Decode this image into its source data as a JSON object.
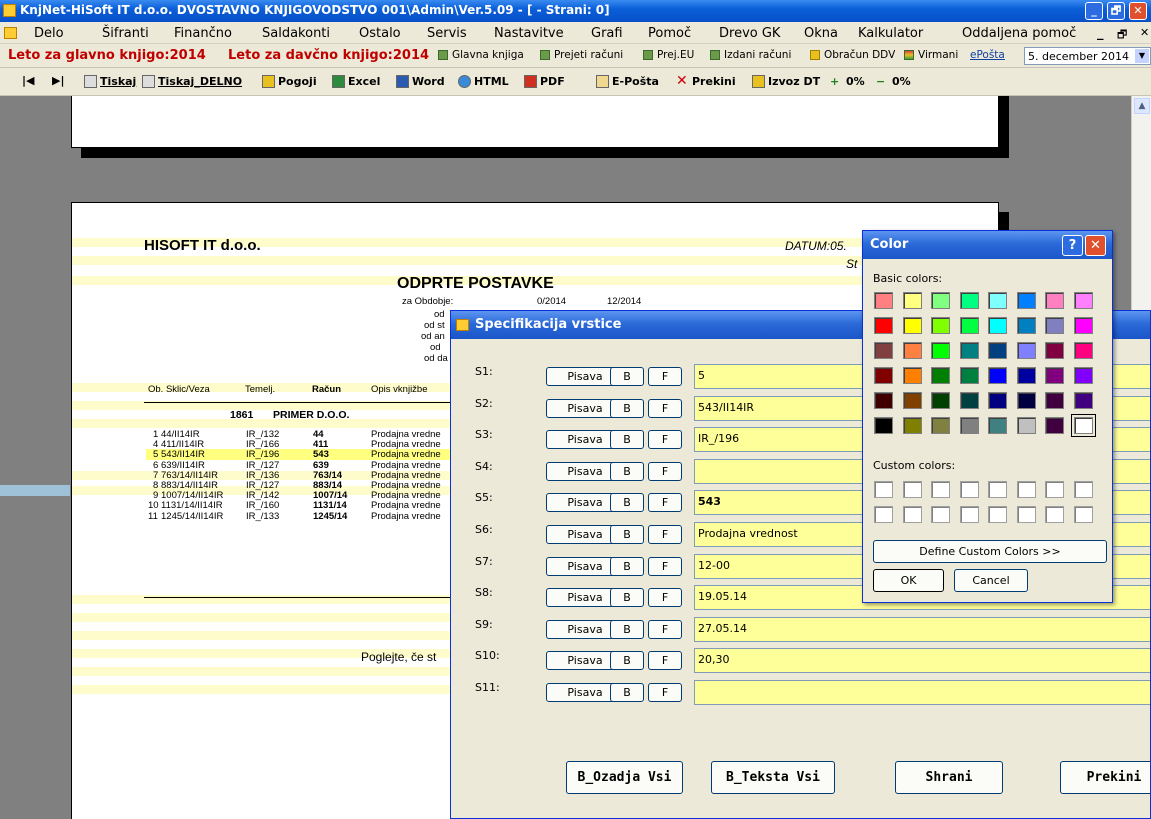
{
  "window": {
    "title": "KnjNet-HiSoft IT d.o.o. DVOSTAVNO KNJIGOVODSTVO 001\\Admin\\Ver.5.09 - [ - Strani: 0]",
    "min": "_",
    "max": "🗗",
    "close": "✕"
  },
  "menu": {
    "items": [
      "Delo",
      "Šifranti",
      "Finančno",
      "Saldakonti",
      "Ostalo",
      "Servis",
      "Nastavitve",
      "Grafi",
      "Pomoč",
      "Drevo GK",
      "Okna",
      "Kalkulator",
      "Oddaljena pomoč"
    ],
    "right_min": "_",
    "right_max": "🗗",
    "right_close": "✕"
  },
  "linkbar": {
    "year_main": "Leto za glavno knjigo:2014",
    "year_tax": "Leto za davčno knjigo:2014",
    "links": [
      "Glavna knjiga",
      "Prejeti računi",
      "Prej.EU",
      "Izdani računi",
      "Obračun DDV",
      "Virmani",
      "ePošta"
    ],
    "date": "5. december 2014"
  },
  "toolbar": {
    "items": [
      "Tiskaj",
      "Tiskaj_DELNO",
      "Pogoji",
      "Excel",
      "Word",
      "HTML",
      "PDF",
      "E-Pošta",
      "Prekini",
      "Izvoz DT",
      "0%",
      "0%"
    ]
  },
  "report": {
    "company": "HISOFT IT d.o.o.",
    "datum": "DATUM:05.",
    "stran": "St",
    "title": "ODPRTE POSTAVKE",
    "period_label": "za Obdobje:",
    "period_from": "0/2014",
    "period_to": "12/2014",
    "filters": [
      "od",
      "od st",
      "od an",
      "od",
      "od da"
    ],
    "headers": {
      "ob": "Ob. Sklic/Veza",
      "temelj": "Temelj.",
      "racun": "Račun",
      "opis": "Opis vknjižbe"
    },
    "partner_code": "1861",
    "partner_name": "PRIMER D.O.O.",
    "rows": [
      {
        "ob": "1",
        "sklic": "44/II14IR",
        "temelj": "IR_/132",
        "racun": "44",
        "opis": "Prodajna vredne"
      },
      {
        "ob": "4",
        "sklic": "411/II14IR",
        "temelj": "IR_/166",
        "racun": "411",
        "opis": "Prodajna vredne"
      },
      {
        "ob": "5",
        "sklic": "543/II14IR",
        "temelj": "IR_/196",
        "racun": "543",
        "opis": "Prodajna vredne"
      },
      {
        "ob": "6",
        "sklic": "639/II14IR",
        "temelj": "IR_/127",
        "racun": "639",
        "opis": "Prodajna vredne"
      },
      {
        "ob": "7",
        "sklic": "763/14/II14IR",
        "temelj": "IR_/136",
        "racun": "763/14",
        "opis": "Prodajna vredne"
      },
      {
        "ob": "8",
        "sklic": "883/14/II14IR",
        "temelj": "IR_/127",
        "racun": "883/14",
        "opis": "Prodajna vredne"
      },
      {
        "ob": "9",
        "sklic": "1007/14/II14IR",
        "temelj": "IR_/142",
        "racun": "1007/14",
        "opis": "Prodajna vredne"
      },
      {
        "ob": "10",
        "sklic": "1131/14/II14IR",
        "temelj": "IR_/160",
        "racun": "1131/14",
        "opis": "Prodajna vredne"
      },
      {
        "ob": "11",
        "sklic": "1245/14/II14IR",
        "temelj": "IR_/133",
        "racun": "1245/14",
        "opis": "Prodajna vredne"
      }
    ],
    "footer": "Poglejte, če st"
  },
  "spec_dialog": {
    "title": "Specifikacija vrstice",
    "pisava": "Pisava",
    "b": "B",
    "f": "F",
    "rows": [
      {
        "label": "S1:",
        "value": "5"
      },
      {
        "label": "S2:",
        "value": "543/II14IR"
      },
      {
        "label": "S3:",
        "value": "IR_/196"
      },
      {
        "label": "S4:",
        "value": ""
      },
      {
        "label": "S5:",
        "value": "543"
      },
      {
        "label": "S6:",
        "value": "Prodajna vrednost"
      },
      {
        "label": "S7:",
        "value": "12-00"
      },
      {
        "label": "S8:",
        "value": "19.05.14"
      },
      {
        "label": "S9:",
        "value": "27.05.14"
      },
      {
        "label": "S10:",
        "value": "20,30"
      },
      {
        "label": "S11:",
        "value": ""
      }
    ],
    "btn_bg_all": "B_Ozadja Vsi",
    "btn_text_all": "B_Teksta Vsi",
    "btn_save": "Shrani",
    "btn_cancel": "Prekini"
  },
  "color_dialog": {
    "title": "Color",
    "help": "?",
    "close": "✕",
    "basic_label": "Basic colors:",
    "custom_label": "Custom colors:",
    "define_btn": "Define Custom Colors >>",
    "ok": "OK",
    "cancel": "Cancel",
    "basic": [
      "#ff8080",
      "#ffff80",
      "#80ff80",
      "#00ff80",
      "#80ffff",
      "#0080ff",
      "#ff80c0",
      "#ff80ff",
      "#ff0000",
      "#ffff00",
      "#80ff00",
      "#00ff40",
      "#00ffff",
      "#0080c0",
      "#8080c0",
      "#ff00ff",
      "#804040",
      "#ff8040",
      "#00ff00",
      "#008080",
      "#004080",
      "#8080ff",
      "#800040",
      "#ff0080",
      "#800000",
      "#ff8000",
      "#008000",
      "#008040",
      "#0000ff",
      "#0000a0",
      "#800080",
      "#8000ff",
      "#400000",
      "#804000",
      "#004000",
      "#004040",
      "#000080",
      "#000040",
      "#400040",
      "#400080",
      "#000000",
      "#808000",
      "#808040",
      "#808080",
      "#408080",
      "#c0c0c0",
      "#400040",
      "#ffffff"
    ]
  }
}
